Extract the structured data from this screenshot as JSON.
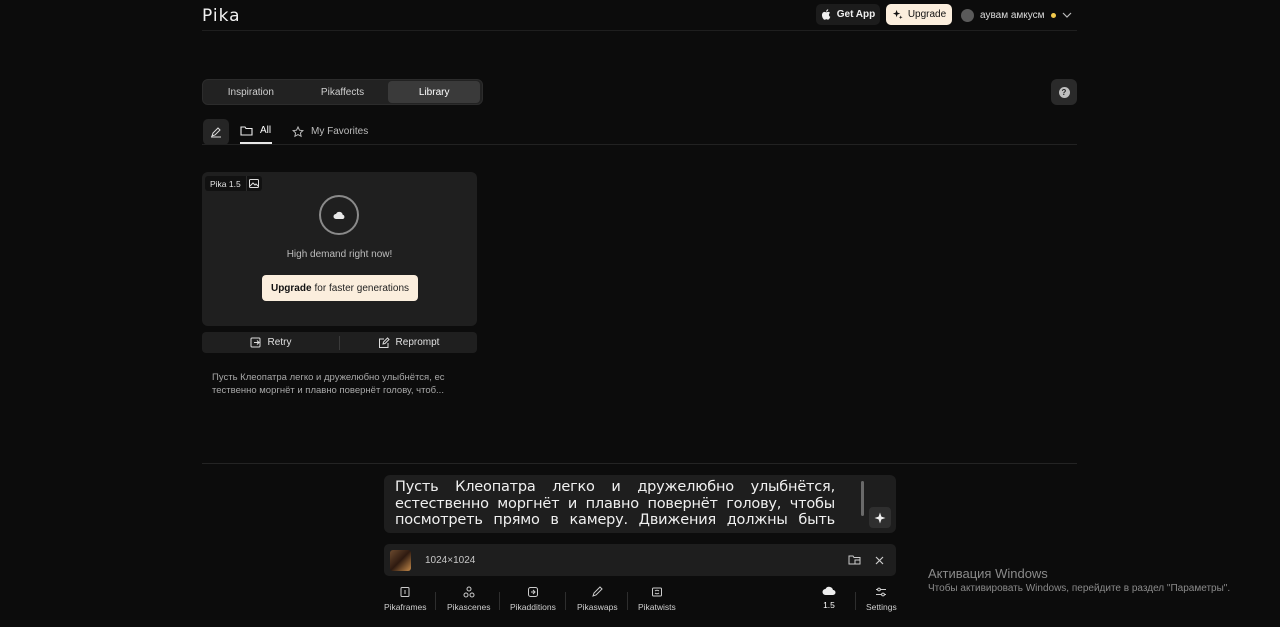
{
  "header": {
    "logo": "Pika",
    "get_app_label": "Get App",
    "upgrade_label": "Upgrade",
    "user_name": "аувам амкусм"
  },
  "tabs": [
    {
      "label": "Inspiration"
    },
    {
      "label": "Pikaffects"
    },
    {
      "label": "Library",
      "active": true
    }
  ],
  "subnav": {
    "all_label": "All",
    "favorites_label": "My Favorites"
  },
  "card": {
    "model_badge": "Pika 1.5",
    "status_text": "High demand right now!",
    "upgrade_bold": "Upgrade",
    "upgrade_rest": "for faster generations",
    "retry_label": "Retry",
    "reprompt_label": "Reprompt",
    "prompt_preview": "Пусть Клеопатра легко и дружелюбно улыбнётся, ес тественно моргнёт и плавно повернёт голову, чтоб..."
  },
  "prompt": {
    "text": "Пусть Клеопатра легко и дружелюбно улыбнётся, естественно моргнёт и плавно повернёт голову, чтобы посмотреть прямо в камеру. Движения должны быть мягкими, изящными и"
  },
  "media": {
    "dimensions": "1024×1024"
  },
  "toolbar": {
    "items": [
      {
        "label": "Pikaframes",
        "icon": "frames-icon"
      },
      {
        "label": "Pikascenes",
        "icon": "scenes-icon"
      },
      {
        "label": "Pikadditions",
        "icon": "additions-icon"
      },
      {
        "label": "Pikaswaps",
        "icon": "swaps-icon"
      },
      {
        "label": "Pikatwists",
        "icon": "twists-icon"
      }
    ],
    "model_label": "1.5",
    "settings_label": "Settings"
  },
  "watermark": {
    "title": "Активация Windows",
    "subtitle": "Чтобы активировать Windows, перейдите в раздел \"Параметры\"."
  },
  "colors": {
    "background": "#0c0c0c",
    "accent_cream": "#fbeedd",
    "status_dot": "#f2c94c"
  }
}
